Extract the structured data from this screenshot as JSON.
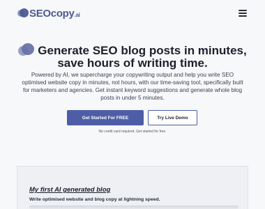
{
  "nav": {
    "logo_text": "SEOcopy",
    "logo_suffix": ".ai",
    "menu_icon": "hamburger-icon"
  },
  "hero": {
    "title_line1": "Generate SEO blog posts in minutes,",
    "title_line2": "save hours of writing time.",
    "lead": "Powered by AI, we supercharge your copywriting output and help you write SEO optimised website copy in minutes, not hours, with our time-saving tool, specifically built for marketers and agencies. Get instant keyword suggestions and generate whole blog posts in under 5 minutes.",
    "cta_primary": "Get Started For FREE",
    "cta_secondary": "Try Live Demo",
    "note": "No credit card required. Get started for free."
  },
  "preview": {
    "title": "My first AI generated blog",
    "subtitle": "Write optimised website and blog copy at lightning speed."
  },
  "colors": {
    "brand": "#4e5ea6",
    "background": "#f7f8fa"
  }
}
